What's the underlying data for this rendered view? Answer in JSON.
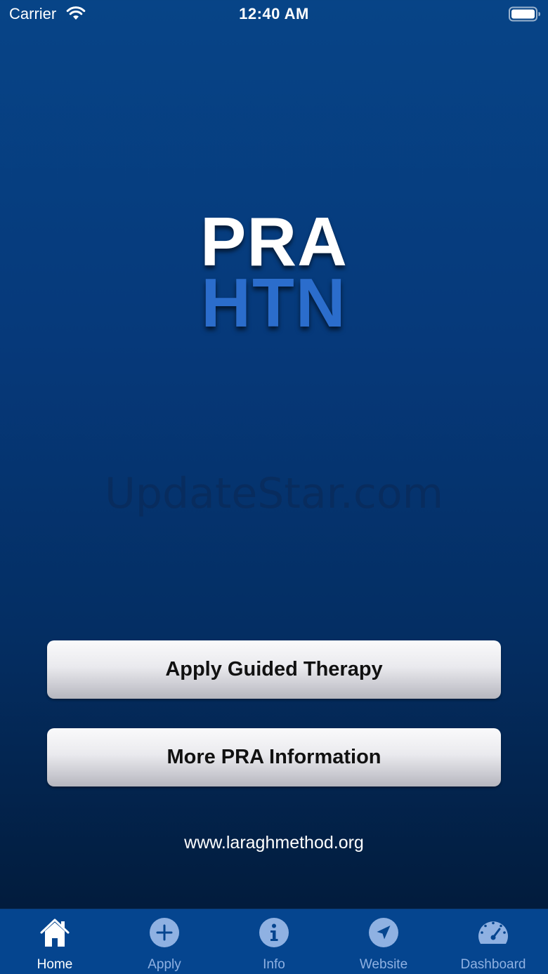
{
  "status_bar": {
    "carrier": "Carrier",
    "time": "12:40 AM"
  },
  "logo": {
    "line1": "PRA",
    "line2": "HTN"
  },
  "watermark": "UpdateStar.com",
  "buttons": {
    "apply_label": "Apply Guided Therapy",
    "info_label": "More PRA Information"
  },
  "website": "www.laraghmethod.org",
  "tabs": [
    {
      "label": "Home",
      "icon": "home-icon",
      "active": true
    },
    {
      "label": "Apply",
      "icon": "plus-circle-icon",
      "active": false
    },
    {
      "label": "Info",
      "icon": "info-circle-icon",
      "active": false
    },
    {
      "label": "Website",
      "icon": "location-arrow-icon",
      "active": false
    },
    {
      "label": "Dashboard",
      "icon": "speedometer-icon",
      "active": false
    }
  ],
  "colors": {
    "background_top": "#074487",
    "background_bottom": "#021a38",
    "logo_accent": "#2b6dcc",
    "tab_bar": "#05458f",
    "tab_active": "#ffffff",
    "tab_inactive": "#8fb1e2"
  }
}
